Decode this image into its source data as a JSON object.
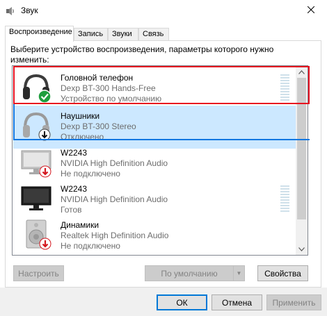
{
  "window": {
    "title": "Звук",
    "close_icon": "close-icon",
    "app_icon": "speaker-icon"
  },
  "tabs": [
    {
      "label": "Воспроизведение",
      "active": true
    },
    {
      "label": "Запись",
      "active": false
    },
    {
      "label": "Звуки",
      "active": false
    },
    {
      "label": "Связь",
      "active": false
    }
  ],
  "instruction": "Выберите устройство воспроизведения, параметры которого нужно изменить:",
  "devices": [
    {
      "name": "Головной телефон",
      "driver": "Dexp BT-300 Hands-Free",
      "status": "Устройство по умолчанию",
      "icon": "headphones-icon",
      "badge": "green-check-icon",
      "selected": false,
      "meter": true
    },
    {
      "name": "Наушники",
      "driver": "Dexp BT-300 Stereo",
      "status": "Отключено",
      "icon": "headphones-icon",
      "badge": "black-down-arrow-icon",
      "selected": true,
      "meter": false
    },
    {
      "name": "W2243",
      "driver": "NVIDIA High Definition Audio",
      "status": "Не подключено",
      "icon": "monitor-icon",
      "badge": "red-down-arrow-icon",
      "selected": false,
      "meter": false
    },
    {
      "name": "W2243",
      "driver": "NVIDIA High Definition Audio",
      "status": "Готов",
      "icon": "monitor-icon",
      "badge": "",
      "selected": false,
      "meter": true
    },
    {
      "name": "Динамики",
      "driver": "Realtek High Definition Audio",
      "status": "Не подключено",
      "icon": "speaker-device-icon",
      "badge": "red-down-arrow-icon",
      "selected": false,
      "meter": false
    }
  ],
  "buttons": {
    "configure": "Настроить",
    "set_default": "По умолчанию",
    "properties": "Свойства",
    "ok": "ОК",
    "cancel": "Отмена",
    "apply": "Применить"
  },
  "colors": {
    "selection": "#cce8ff",
    "highlight_red": "#e8101f",
    "highlight_blue": "#1277e1",
    "default_button_border": "#0078d7",
    "check_green": "#1e9e3e",
    "arrow_red": "#d4161e"
  }
}
